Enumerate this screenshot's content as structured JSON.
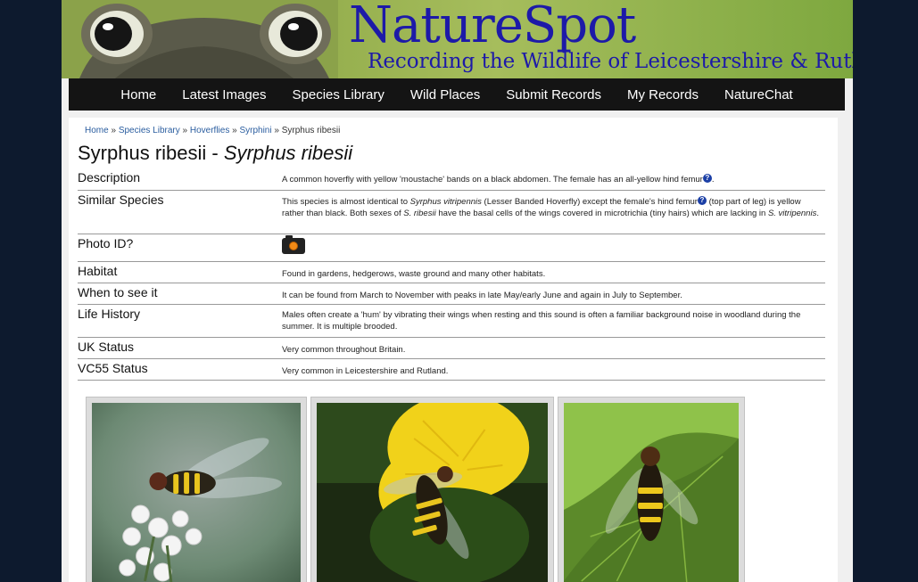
{
  "banner": {
    "title": "NatureSpot",
    "subtitle": "Recording the Wildlife of Leicestershire & Rutland"
  },
  "nav": [
    "Home",
    "Latest Images",
    "Species Library",
    "Wild Places",
    "Submit Records",
    "My Records",
    "NatureChat"
  ],
  "breadcrumb": {
    "items": [
      "Home",
      "Species Library",
      "Hoverflies",
      "Syrphini"
    ],
    "current": "Syrphus ribesii",
    "separator": "»"
  },
  "page": {
    "title_plain": "Syrphus ribesii - ",
    "title_italic": "Syrphus ribesii"
  },
  "facts": {
    "description": {
      "label": "Description",
      "text": " A common hoverfly with yellow 'moustache' bands on a black abdomen. The female has an all-yellow hind femur",
      "suffix": "."
    },
    "similar": {
      "label": "Similar Species",
      "t1": "This species is almost identical to ",
      "i1": "Syrphus vitripennis",
      "t2": " (Lesser Banded Hoverfly) except the female's hind femur",
      "t3": " (top part of leg) is yellow rather than black. Both sexes of ",
      "i2": "S. ribesii",
      "t4": " have the basal cells of the wings covered in microtrichia (tiny hairs) which are lacking in ",
      "i3": "S. vitripennis",
      "t5": "."
    },
    "photo_id": {
      "label": "Photo ID?",
      "icon": "camera-icon"
    },
    "habitat": {
      "label": "Habitat",
      "text": "Found in gardens, hedgerows, waste ground and many other habitats."
    },
    "when": {
      "label": "When to see it",
      "text": "It can be found from March to November with peaks in late May/early June and again in July to September."
    },
    "life": {
      "label": "Life History",
      "text": "Males often create a 'hum' by vibrating their wings when resting and this sound is often a familiar background noise in woodland during the summer. It is multiple brooded."
    },
    "uk": {
      "label": "UK Status",
      "text": "Very common throughout Britain."
    },
    "vc55": {
      "label": "VC55 Status",
      "text": "Very common in Leicestershire and Rutland."
    }
  },
  "help_icon": "?",
  "colors": {
    "link": "#2a5d9f",
    "nav_bg": "#141414",
    "logo": "#1d1aa8",
    "page_bg": "#0d1a2e"
  }
}
